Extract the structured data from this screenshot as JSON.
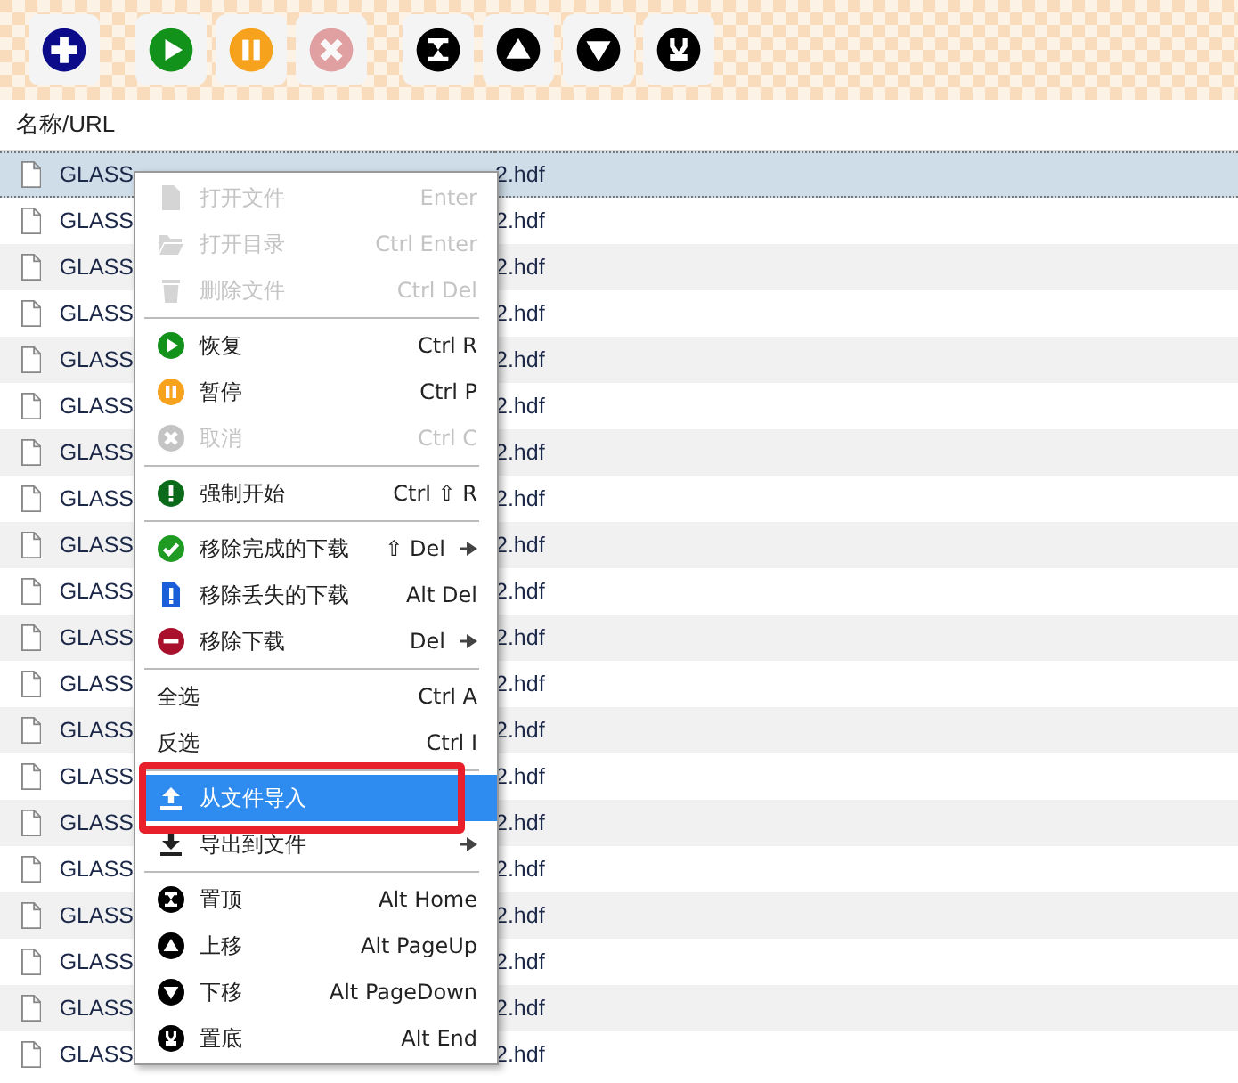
{
  "toolbar": [
    {
      "disabled": false
    },
    {
      "disabled": false
    },
    {
      "disabled": false
    },
    {
      "disabled": true
    },
    {
      "disabled": false
    },
    {
      "disabled": false
    },
    {
      "disabled": false
    },
    {
      "disabled": false
    }
  ],
  "table": {
    "columns": [
      "名称/URL"
    ],
    "rows": [
      {
        "name_start": "GLASS",
        "name_end": "2.hdf",
        "selected": true
      },
      {
        "name_start": "GLASS",
        "name_end": "2.hdf",
        "selected": false
      },
      {
        "name_start": "GLASS",
        "name_end": "2.hdf",
        "selected": false
      },
      {
        "name_start": "GLASS",
        "name_end": "2.hdf",
        "selected": false
      },
      {
        "name_start": "GLASS",
        "name_end": "2.hdf",
        "selected": false
      },
      {
        "name_start": "GLASS",
        "name_end": "2.hdf",
        "selected": false
      },
      {
        "name_start": "GLASS",
        "name_end": "2.hdf",
        "selected": false
      },
      {
        "name_start": "GLASS",
        "name_end": "2.hdf",
        "selected": false
      },
      {
        "name_start": "GLASS",
        "name_end": "2.hdf",
        "selected": false
      },
      {
        "name_start": "GLASS",
        "name_end": "2.hdf",
        "selected": false
      },
      {
        "name_start": "GLASS",
        "name_end": "2.hdf",
        "selected": false
      },
      {
        "name_start": "GLASS",
        "name_end": "2.hdf",
        "selected": false
      },
      {
        "name_start": "GLASS",
        "name_end": "2.hdf",
        "selected": false
      },
      {
        "name_start": "GLASS",
        "name_end": "2.hdf",
        "selected": false
      },
      {
        "name_start": "GLASS",
        "name_end": "2.hdf",
        "selected": false
      },
      {
        "name_start": "GLASS",
        "name_end": "2.hdf",
        "selected": false
      },
      {
        "name_start": "GLASS",
        "name_end": "2.hdf",
        "selected": false
      },
      {
        "name_start": "GLASS",
        "name_end": "2.hdf",
        "selected": false
      },
      {
        "name_start": "GLASS",
        "name_end": "2.hdf",
        "selected": false
      },
      {
        "name_start": "GLASS",
        "name_end": "2.hdf",
        "selected": false
      }
    ]
  },
  "context_menu": {
    "items": [
      {
        "kind": "item",
        "label": "打开文件",
        "shortcut": "Enter",
        "disabled": true,
        "selected": false,
        "submenu": false
      },
      {
        "kind": "item",
        "label": "打开目录",
        "shortcut": "Ctrl Enter",
        "disabled": true,
        "selected": false,
        "submenu": false
      },
      {
        "kind": "item",
        "label": "删除文件",
        "shortcut": "Ctrl Del",
        "disabled": true,
        "selected": false,
        "submenu": false
      },
      {
        "kind": "separator"
      },
      {
        "kind": "item",
        "label": "恢复",
        "shortcut": "Ctrl R",
        "disabled": false,
        "selected": false,
        "submenu": false
      },
      {
        "kind": "item",
        "label": "暂停",
        "shortcut": "Ctrl P",
        "disabled": false,
        "selected": false,
        "submenu": false
      },
      {
        "kind": "item",
        "label": "取消",
        "shortcut": "Ctrl C",
        "disabled": true,
        "selected": false,
        "submenu": false
      },
      {
        "kind": "separator"
      },
      {
        "kind": "item",
        "label": "强制开始",
        "shortcut": "Ctrl ⇧ R",
        "disabled": false,
        "selected": false,
        "submenu": false
      },
      {
        "kind": "separator"
      },
      {
        "kind": "item",
        "label": "移除完成的下载",
        "shortcut": "⇧ Del",
        "disabled": false,
        "selected": false,
        "submenu": true
      },
      {
        "kind": "item",
        "label": "移除丢失的下载",
        "shortcut": "Alt Del",
        "disabled": false,
        "selected": false,
        "submenu": false
      },
      {
        "kind": "item",
        "label": "移除下载",
        "shortcut": "Del",
        "disabled": false,
        "selected": false,
        "submenu": true
      },
      {
        "kind": "separator"
      },
      {
        "kind": "item",
        "label": "全选",
        "shortcut": "Ctrl A",
        "disabled": false,
        "selected": false,
        "submenu": false
      },
      {
        "kind": "item",
        "label": "反选",
        "shortcut": "Ctrl I",
        "disabled": false,
        "selected": false,
        "submenu": false
      },
      {
        "kind": "separator"
      },
      {
        "kind": "item",
        "label": "从文件导入",
        "disabled": false,
        "selected": true,
        "highlighted": true,
        "submenu": false
      },
      {
        "kind": "item",
        "label": "导出到文件",
        "disabled": false,
        "selected": false,
        "submenu": true
      },
      {
        "kind": "separator"
      },
      {
        "kind": "item",
        "label": "置顶",
        "shortcut": "Alt Home",
        "disabled": false,
        "selected": false,
        "submenu": false
      },
      {
        "kind": "item",
        "label": "上移",
        "shortcut": "Alt PageUp",
        "disabled": false,
        "selected": false,
        "submenu": false
      },
      {
        "kind": "item",
        "label": "下移",
        "shortcut": "Alt PageDown",
        "disabled": false,
        "selected": false,
        "submenu": false
      },
      {
        "kind": "item",
        "label": "置底",
        "shortcut": "Alt End",
        "disabled": false,
        "selected": false,
        "submenu": false
      }
    ]
  }
}
